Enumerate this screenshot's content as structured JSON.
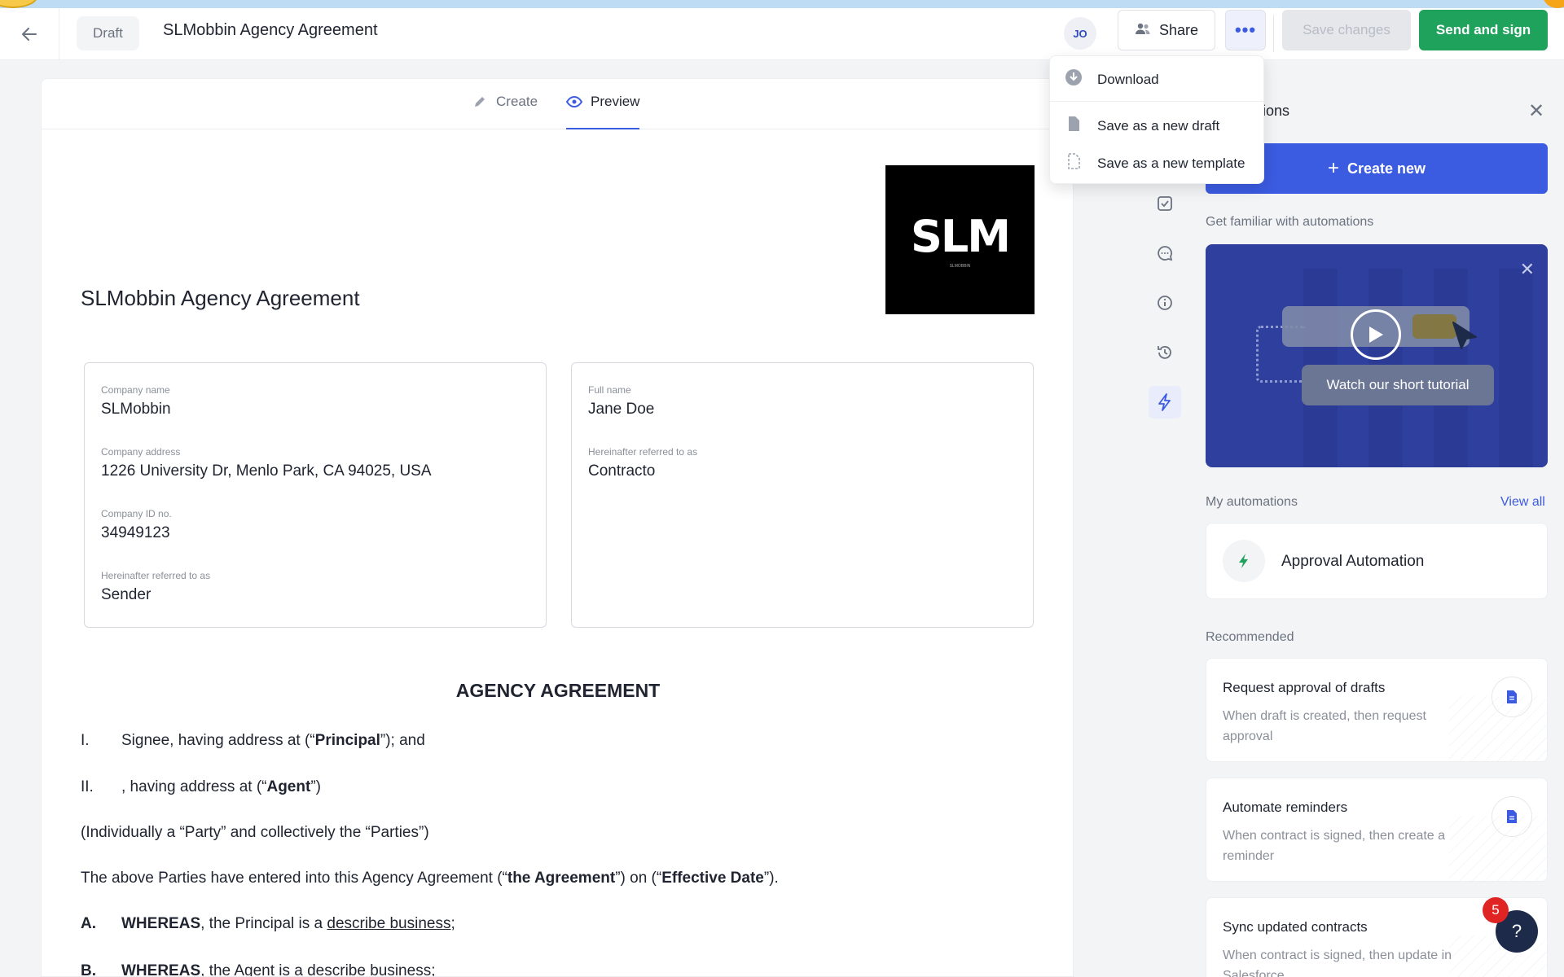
{
  "header": {
    "draft_label": "Draft",
    "doc_title": "SLMobbin Agency Agreement",
    "avatar_initials": "JO",
    "share_label": "Share",
    "save_label": "Save changes",
    "send_label": "Send and sign"
  },
  "tabs": [
    {
      "label": "Create",
      "icon": "pencil-icon",
      "active": false
    },
    {
      "label": "Preview",
      "icon": "eye-icon",
      "active": true
    }
  ],
  "dropdown": {
    "items": [
      {
        "label": "Download",
        "icon": "download-icon"
      },
      {
        "label": "Save as a new draft",
        "icon": "file-icon"
      },
      {
        "label": "Save as a new template",
        "icon": "template-icon"
      }
    ]
  },
  "document": {
    "logo_text": "SLM",
    "logo_subtext": "SLMOBBIN",
    "title": "SLMobbin Agency Agreement",
    "party_left": [
      {
        "label": "Company name",
        "value": "SLMobbin"
      },
      {
        "label": "Company address",
        "value": "1226 University Dr, Menlo Park, CA 94025, USA"
      },
      {
        "label": "Company ID no.",
        "value": "34949123"
      },
      {
        "label": "Hereinafter referred to as",
        "value": "Sender"
      }
    ],
    "party_right": [
      {
        "label": "Full name",
        "value": "Jane Doe"
      },
      {
        "label": "Hereinafter referred to as",
        "value": "Contracto"
      }
    ],
    "agreement_title": "AGENCY AGREEMENT",
    "clauses": {
      "i_num": "I.",
      "i_pre": "Signee, having address at  (“",
      "i_bold": "Principal",
      "i_post": "”); and",
      "ii_num": "II.",
      "ii_pre": ", having address at  (“",
      "ii_bold": "Agent",
      "ii_post": "”)",
      "individually": "(Individually a “Party” and collectively the “Parties”)",
      "above_pre": "The above Parties have entered into this Agency Agreement (“",
      "above_bold1": "the Agreement",
      "above_mid": "”) on  (“",
      "above_bold2": "Effective Date",
      "above_post": "”).",
      "a_num": "A.",
      "a_bold": "WHEREAS",
      "a_pre": ", the Principal is a ",
      "a_link": "describe business",
      "a_post": ";",
      "b_num": "B.",
      "b_bold": "WHEREAS",
      "b_pre": ", the Agent is a ",
      "b_link": "describe business",
      "b_post": ";"
    }
  },
  "panel": {
    "title_visible": "ions",
    "create_new_label": "Create new",
    "familiar_label": "Get familiar with automations",
    "video_label": "Watch our short tutorial",
    "my_automations_label": "My automations",
    "view_all_label": "View all",
    "automation_name": "Approval Automation",
    "recommended_label": "Recommended",
    "recommended": [
      {
        "title": "Request approval of drafts",
        "desc": "When draft is created, then request approval"
      },
      {
        "title": "Automate reminders",
        "desc": "When contract is signed, then create a reminder"
      },
      {
        "title": "Sync updated contracts",
        "desc": "When contract is signed, then update in Salesforce"
      }
    ]
  },
  "help": {
    "badge_count": "5",
    "label": "?"
  },
  "colors": {
    "accent": "#3b5be0",
    "success": "#1fa35c",
    "badge": "#e02424"
  }
}
